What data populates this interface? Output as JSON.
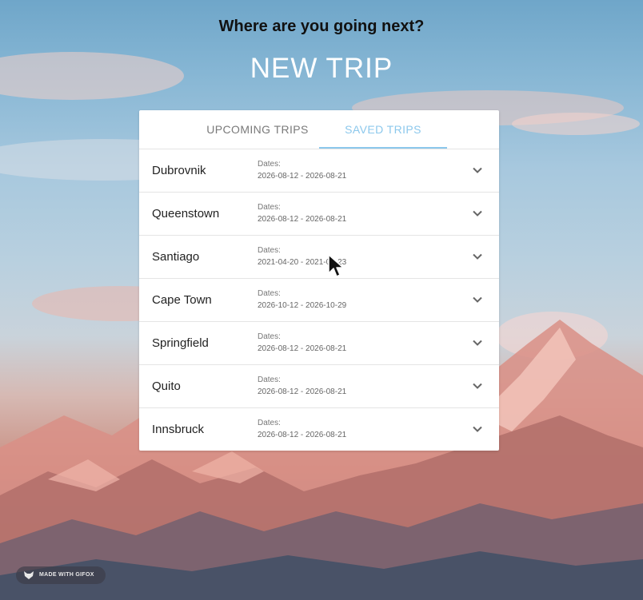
{
  "page": {
    "heading": "Where are you going next?",
    "title": "NEW TRIP"
  },
  "tabs": [
    {
      "label": "UPCOMING TRIPS",
      "active": false
    },
    {
      "label": "SAVED TRIPS",
      "active": true
    }
  ],
  "trips": [
    {
      "city": "Dubrovnik",
      "dates_label": "Dates:",
      "dates": "2026-08-12 - 2026-08-21"
    },
    {
      "city": "Queenstown",
      "dates_label": "Dates:",
      "dates": "2026-08-12 - 2026-08-21"
    },
    {
      "city": "Santiago",
      "dates_label": "Dates:",
      "dates": "2021-04-20 - 2021-04-23"
    },
    {
      "city": "Cape Town",
      "dates_label": "Dates:",
      "dates": "2026-10-12 - 2026-10-29"
    },
    {
      "city": "Springfield",
      "dates_label": "Dates:",
      "dates": "2026-08-12 - 2026-08-21"
    },
    {
      "city": "Quito",
      "dates_label": "Dates:",
      "dates": "2026-08-12 - 2026-08-21"
    },
    {
      "city": "Innsbruck",
      "dates_label": "Dates:",
      "dates": "2026-08-12 - 2026-08-21"
    }
  ],
  "badge": {
    "label": "MADE WITH GIFOX",
    "icon": "fox-icon"
  },
  "icons": {
    "expand": "chevron-down-icon",
    "cursor": "mouse-cursor-icon"
  },
  "colors": {
    "accent": "#8cc8ec",
    "title": "#ffffff",
    "heading": "#111111"
  }
}
